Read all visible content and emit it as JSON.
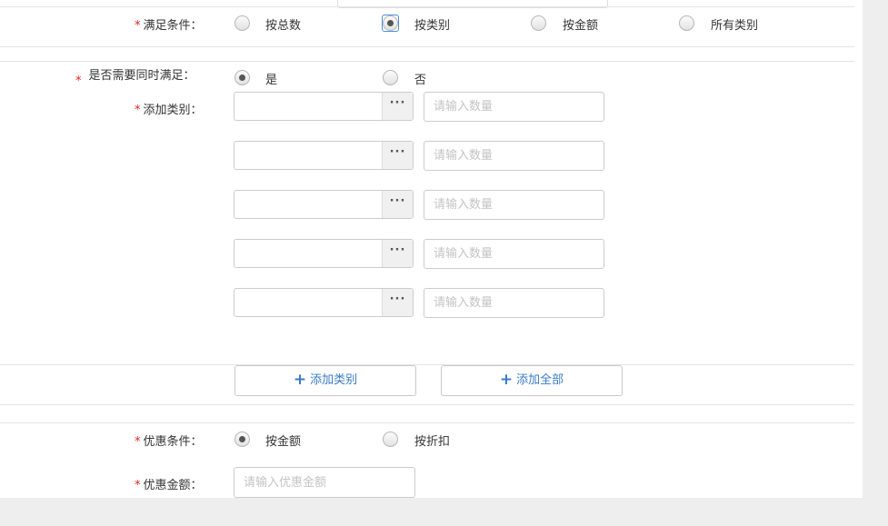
{
  "satisfy": {
    "label": "满足条件：",
    "options": [
      "按总数",
      "按类别",
      "按金额",
      "所有类别"
    ],
    "selected_index": 1
  },
  "simultaneous": {
    "label": "是否需要同时满足：",
    "options": [
      "是",
      "否"
    ],
    "selected_index": 0
  },
  "add_category": {
    "label": "添加类别：",
    "picker_button": "···",
    "qty_placeholder": "请输入数量",
    "rows": [
      {
        "category": "",
        "qty": ""
      },
      {
        "category": "",
        "qty": ""
      },
      {
        "category": "",
        "qty": ""
      },
      {
        "category": "",
        "qty": ""
      },
      {
        "category": "",
        "qty": ""
      }
    ]
  },
  "actions": {
    "add_category_button": "添加类别",
    "add_all_button": "添加全部",
    "plus_symbol": "+"
  },
  "discount": {
    "label": "优惠条件：",
    "options": [
      "按金额",
      "按折扣"
    ],
    "selected_index": 0
  },
  "discount_amount": {
    "label": "优惠金额：",
    "placeholder": "请输入优惠金额",
    "value": ""
  },
  "required_marker": "*",
  "colors": {
    "required": "#e2231a",
    "link_blue": "#3a7bc8",
    "focus_blue": "#4a90e2",
    "page_bg": "#eeeeee"
  }
}
